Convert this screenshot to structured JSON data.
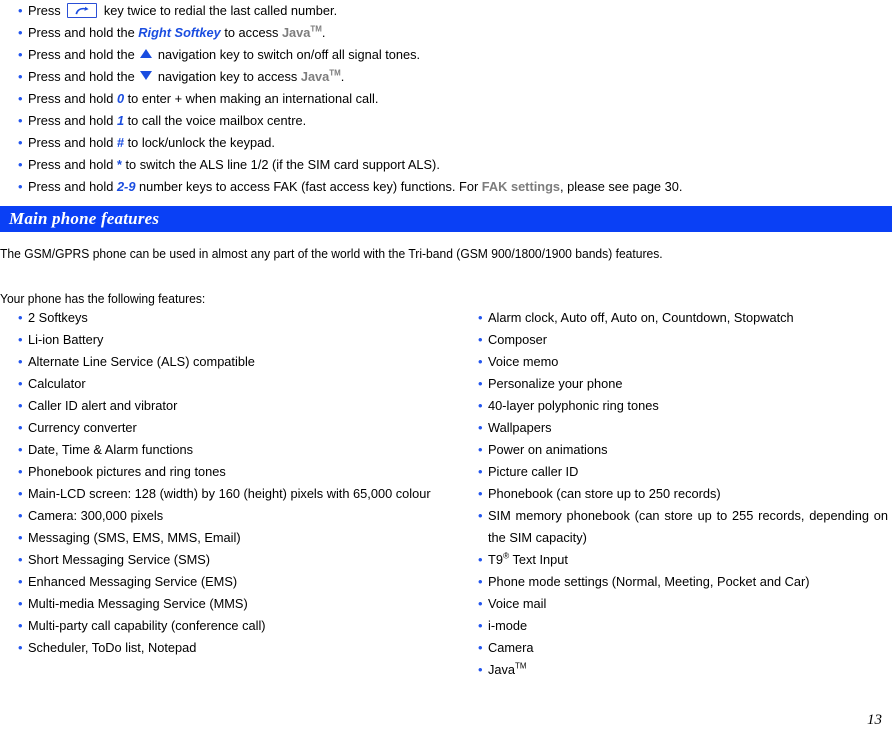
{
  "top_instructions": {
    "items": [
      {
        "id": "redial",
        "segments": [
          {
            "type": "text",
            "text": "Press "
          },
          {
            "type": "icon",
            "icon": "call-key-icon"
          },
          {
            "type": "text",
            "text": " key twice to redial the last called number."
          }
        ]
      },
      {
        "id": "right-softkey",
        "segments": [
          {
            "type": "text",
            "text": "Press and hold the "
          },
          {
            "type": "blue-bold-italic",
            "text": "Right Softkey"
          },
          {
            "type": "text",
            "text": " to access "
          },
          {
            "type": "gray-bold",
            "text": "Java"
          },
          {
            "type": "sup-gray-bold",
            "text": "TM"
          },
          {
            "type": "text",
            "text": "."
          }
        ]
      },
      {
        "id": "signal-tones",
        "segments": [
          {
            "type": "text",
            "text": "Press and hold the "
          },
          {
            "type": "icon",
            "icon": "arrow-up-icon"
          },
          {
            "type": "text",
            "text": " navigation key to switch on/off all signal tones."
          }
        ]
      },
      {
        "id": "nav-down-java",
        "segments": [
          {
            "type": "text",
            "text": "Press and hold the "
          },
          {
            "type": "icon",
            "icon": "arrow-down-icon"
          },
          {
            "type": "text",
            "text": " navigation key to access "
          },
          {
            "type": "gray-bold",
            "text": "Java"
          },
          {
            "type": "sup-gray-bold",
            "text": "TM"
          },
          {
            "type": "text",
            "text": "."
          }
        ]
      },
      {
        "id": "key-0",
        "segments": [
          {
            "type": "text",
            "text": "Press and hold "
          },
          {
            "type": "blue-bold-italic",
            "text": "0"
          },
          {
            "type": "text",
            "text": " to enter + when making an international call."
          }
        ]
      },
      {
        "id": "key-1",
        "segments": [
          {
            "type": "text",
            "text": "Press and hold "
          },
          {
            "type": "blue-bold-italic",
            "text": "1"
          },
          {
            "type": "text",
            "text": " to call the voice mailbox centre."
          }
        ]
      },
      {
        "id": "key-hash",
        "segments": [
          {
            "type": "text",
            "text": "Press and hold "
          },
          {
            "type": "blue-bold",
            "text": "#"
          },
          {
            "type": "text",
            "text": " to lock/unlock the keypad."
          }
        ]
      },
      {
        "id": "key-star",
        "segments": [
          {
            "type": "text",
            "text": "Press and hold "
          },
          {
            "type": "blue-bold",
            "text": "*"
          },
          {
            "type": "text",
            "text": " to switch the ALS line 1/2 (if the SIM card support ALS)."
          }
        ]
      },
      {
        "id": "key-2-9",
        "segments": [
          {
            "type": "text",
            "text": "Press and hold "
          },
          {
            "type": "blue-bold-italic",
            "text": "2-9"
          },
          {
            "type": "text",
            "text": " number keys to access FAK (fast access key) functions. For "
          },
          {
            "type": "gray-bold",
            "text": "FAK settings"
          },
          {
            "type": "text",
            "text": ", please see page 30."
          }
        ]
      }
    ]
  },
  "section": {
    "title": "Main phone features",
    "bar_color": "#0a40f5",
    "title_color": "#ffffff"
  },
  "body": {
    "intro": "The GSM/GPRS phone can be used in almost any part of the world with the Tri-band (GSM 900/1800/1900 bands) features.",
    "features_lead": "Your phone has the following features:"
  },
  "features": {
    "left_column": [
      {
        "text": "2 Softkeys"
      },
      {
        "text": "Li-ion Battery"
      },
      {
        "text": "Alternate Line Service (ALS) compatible"
      },
      {
        "text": "Calculator"
      },
      {
        "text": "Caller ID alert and vibrator"
      },
      {
        "text": "Currency converter"
      },
      {
        "text": "Date, Time & Alarm functions"
      },
      {
        "text": "Phonebook pictures and ring tones"
      },
      {
        "text": "Main-LCD screen: 128 (width) by 160 (height) pixels with 65,000 colour",
        "wrap": true
      },
      {
        "text": "Camera: 300,000 pixels"
      },
      {
        "text": "Messaging (SMS, EMS, MMS, Email)"
      },
      {
        "text": "Short Messaging Service (SMS)"
      },
      {
        "text": "Enhanced Messaging Service (EMS)"
      },
      {
        "text": "Multi-media Messaging Service (MMS)"
      },
      {
        "text": "Multi-party call capability (conference call)"
      },
      {
        "text": "Scheduler, ToDo list, Notepad"
      }
    ],
    "right_column": [
      {
        "text": "Alarm clock, Auto off, Auto on, Countdown, Stopwatch"
      },
      {
        "text": "Composer"
      },
      {
        "text": "Voice memo"
      },
      {
        "text": "Personalize your phone"
      },
      {
        "text": "40-layer polyphonic ring tones"
      },
      {
        "text": "Wallpapers"
      },
      {
        "text": "Power on animations"
      },
      {
        "text": "Picture caller ID"
      },
      {
        "text": "Phonebook (can store up to 250 records)"
      },
      {
        "text": "SIM memory phonebook (can store up to 255 records, depending on the SIM capacity)",
        "wrap": true
      },
      {
        "text": "T9",
        "sup_reg": "®",
        "suffix": " Text Input"
      },
      {
        "text": "Phone mode settings (Normal, Meeting, Pocket and Car)"
      },
      {
        "text": "Voice mail"
      },
      {
        "text": "i-mode"
      },
      {
        "text": "Camera"
      },
      {
        "text": "Java",
        "sup": "TM"
      }
    ]
  },
  "footer": {
    "page_number": "13"
  },
  "colors": {
    "bullet": "#2255ee",
    "accent_blue": "#1a4de0",
    "gray_text": "#7d7d7d",
    "bar_blue": "#0a40f5"
  }
}
